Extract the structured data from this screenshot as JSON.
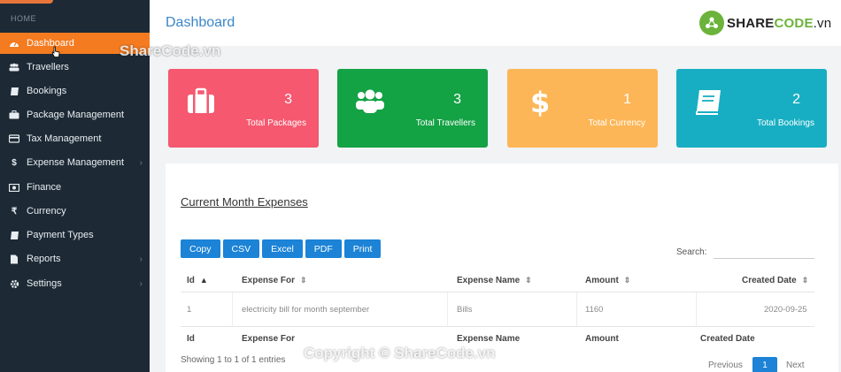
{
  "sidebar": {
    "section": "HOME",
    "items": [
      {
        "label": "Dashboard",
        "icon": "dashboard-icon",
        "active": true
      },
      {
        "label": "Travellers",
        "icon": "users-icon"
      },
      {
        "label": "Bookings",
        "icon": "book-icon"
      },
      {
        "label": "Package Management",
        "icon": "briefcase-icon"
      },
      {
        "label": "Tax Management",
        "icon": "credit-card-icon"
      },
      {
        "label": "Expense Management",
        "icon": "dollar-icon",
        "submenu": true
      },
      {
        "label": "Finance",
        "icon": "money-icon"
      },
      {
        "label": "Currency",
        "icon": "rupee-icon"
      },
      {
        "label": "Payment Types",
        "icon": "book-icon"
      },
      {
        "label": "Reports",
        "icon": "file-icon",
        "submenu": true
      },
      {
        "label": "Settings",
        "icon": "gear-icon",
        "submenu": true
      }
    ]
  },
  "header": {
    "title": "Dashboard",
    "brand": {
      "part1": "SHARE",
      "part2": "CODE",
      "part3": ".vn"
    }
  },
  "watermarks": {
    "top": "ShareCode.vn",
    "bottom": "Copyright © ShareCode.vn"
  },
  "cards": [
    {
      "value": "3",
      "label": "Total Packages",
      "color": "#f5586f",
      "icon": "suitcase-icon"
    },
    {
      "value": "3",
      "label": "Total Travellers",
      "color": "#13a244",
      "icon": "users-icon"
    },
    {
      "value": "1",
      "label": "Total Currency",
      "color": "#fdb657",
      "icon": "dollar-icon"
    },
    {
      "value": "2",
      "label": "Total Bookings",
      "color": "#17aec3",
      "icon": "book-icon"
    }
  ],
  "expenses": {
    "title": "Current Month Expenses",
    "buttons": [
      "Copy",
      "CSV",
      "Excel",
      "PDF",
      "Print"
    ],
    "search_label": "Search:",
    "columns": [
      "Id",
      "Expense For",
      "Expense Name",
      "Amount",
      "Created Date"
    ],
    "rows": [
      {
        "id": "1",
        "expense_for": "electricity bill for month september",
        "expense_name": "Bills",
        "amount": "1160",
        "created": "2020-09-25"
      }
    ],
    "info": "Showing 1 to 1 of 1 entries",
    "pagination": {
      "prev": "Previous",
      "current": "1",
      "next": "Next"
    }
  }
}
